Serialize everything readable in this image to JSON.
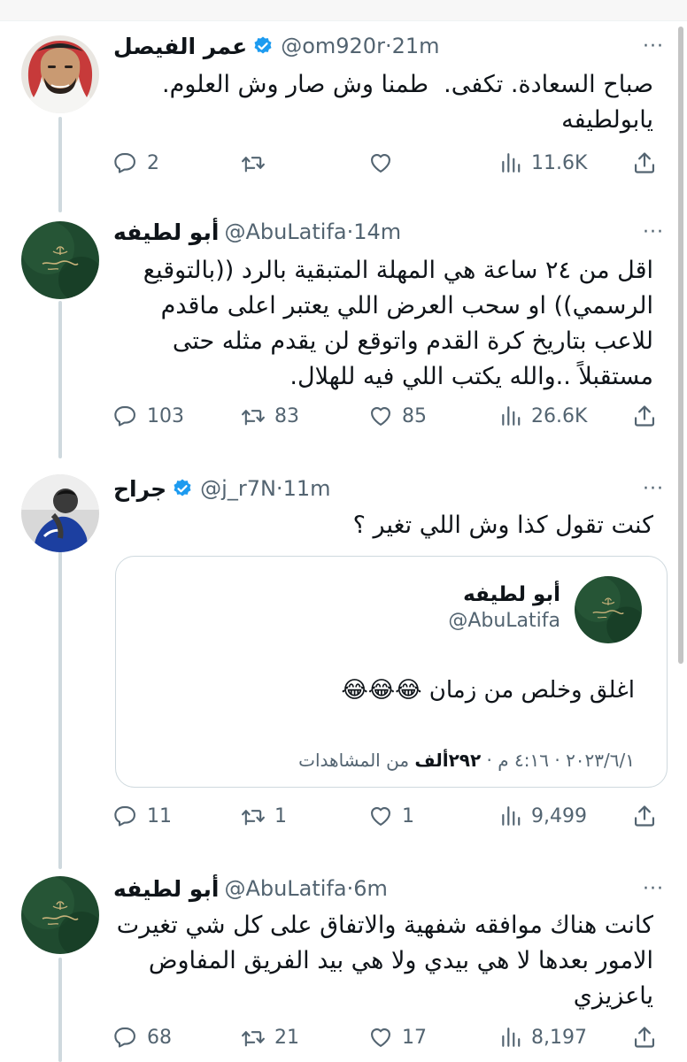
{
  "colors": {
    "verified": "#1d9bf0",
    "muted": "#536471",
    "text": "#0f1419",
    "emblem_bg": "#1f4a2f"
  },
  "icons": {
    "reply": "reply-icon",
    "retweet": "retweet-icon",
    "like": "like-icon",
    "views": "views-icon",
    "share": "share-icon",
    "more": "more-icon",
    "verified": "verified-badge-icon"
  },
  "tweets": [
    {
      "name": "عمر الفيصل",
      "verified": true,
      "handle": "@om920r",
      "time": "21m",
      "text": "صباح السعادة. تكفى.  طمنا وش صار وش العلوم.\nيابولطيفه",
      "replies": "2",
      "retweets": "",
      "likes": "",
      "views": "11.6K"
    },
    {
      "name": "أبو لطيفه",
      "verified": false,
      "handle": "@AbuLatifa",
      "time": "14m",
      "text": "اقل من ٢٤ ساعة هي المهلة المتبقية بالرد ((بالتوقيع الرسمي)) او سحب العرض اللي يعتبر اعلى ماقدم للاعب بتاريخ كرة القدم واتوقع لن يقدم مثله حتى مستقبلاً ..والله يكتب اللي فيه للهلال.",
      "replies": "103",
      "retweets": "83",
      "likes": "85",
      "views": "26.6K"
    },
    {
      "name": "جراح",
      "verified": true,
      "handle": "@j_r7N",
      "time": "11m",
      "text": "كنت تقول كذا وش اللي تغير ؟",
      "quote": {
        "name": "أبو لطيفه",
        "handle": "@AbuLatifa",
        "text": "اغلق وخلص من زمان 😂😂😂",
        "date": "٢٠٢٣/٦/١ · ٤:١٦ م · ",
        "views_count": "٢٩٢ألف",
        "views_label": " من المشاهدات"
      },
      "replies": "11",
      "retweets": "1",
      "likes": "1",
      "views": "9,499"
    },
    {
      "name": "أبو لطيفه",
      "verified": false,
      "handle": "@AbuLatifa",
      "time": "6m",
      "text": "كانت هناك موافقه شفهية والاتفاق على كل شي تغيرت الامور بعدها لا هي بيدي ولا هي بيد الفريق المفاوض ياعزيزي",
      "replies": "68",
      "retweets": "21",
      "likes": "17",
      "views": "8,197"
    }
  ]
}
